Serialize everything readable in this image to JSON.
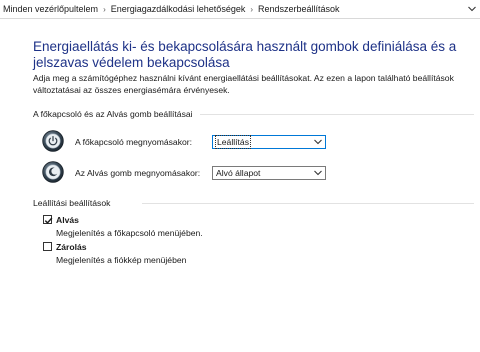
{
  "breadcrumb": {
    "items": [
      "Minden vezérlőpultelem",
      "Energiagazdálkodási lehetőségek",
      "Rendszerbeállítások"
    ],
    "separator": "›"
  },
  "page": {
    "heading": "Energiaellátás ki- és bekapcsolására használt gombok definiálása és a jelszavas védelem bekapcsolása",
    "description": "Adja meg a számítógéphez használni kívánt energiaellátási beállításokat. Az ezen a lapon található beállítások változtatásai az összes energiasémára érvényesek."
  },
  "button_settings": {
    "title": "A főkapcsoló és az Alvás gomb beállításai",
    "power_button": {
      "label": "A főkapcsoló megnyomásakor:",
      "value": "Leállítás",
      "icon": "power-button-icon"
    },
    "sleep_button": {
      "label": "Az Alvás gomb megnyomásakor:",
      "value": "Alvó állapot",
      "icon": "sleep-button-icon"
    }
  },
  "shutdown_settings": {
    "title": "Leállítási beállítások",
    "options": [
      {
        "label": "Alvás",
        "description": "Megjelenítés a főkapcsoló menüjében.",
        "checked": true
      },
      {
        "label": "Zárolás",
        "description": "Megjelenítés a fiókkép menüjében",
        "checked": false
      }
    ]
  },
  "colors": {
    "heading": "#1e3287",
    "focus_border": "#0078d7"
  }
}
